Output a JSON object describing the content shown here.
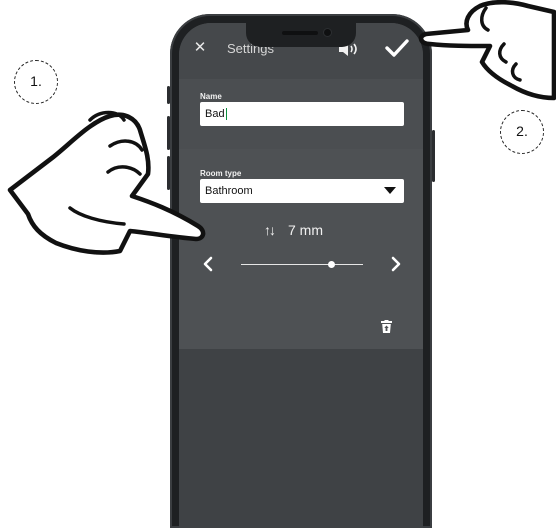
{
  "header": {
    "title": "Settings",
    "close_icon": "close-icon",
    "sound_icon": "speaker-sound-icon",
    "confirm_icon": "checkmark-icon"
  },
  "name_field": {
    "label": "Name",
    "value": "Bad"
  },
  "room_type": {
    "label": "Room type",
    "selected": "Bathroom"
  },
  "thickness": {
    "icon": "up-down-arrows-icon",
    "value": "7 mm",
    "slider_fraction": 0.74
  },
  "delete": {
    "icon": "trash-icon"
  },
  "callouts": [
    {
      "label": "1."
    },
    {
      "label": "2."
    }
  ],
  "colors": {
    "screen": "#434649",
    "text": "#f1f1f1",
    "phone_body": "#1e2022"
  }
}
